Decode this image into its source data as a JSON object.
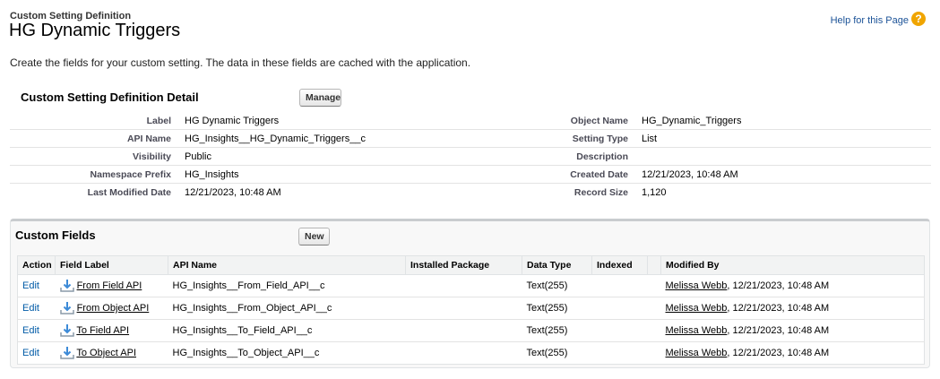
{
  "header": {
    "breadcrumb": "Custom Setting Definition",
    "title": "HG Dynamic Triggers",
    "help_link": "Help for this Page",
    "help_icon_glyph": "?",
    "description": "Create the fields for your custom setting. The data in these fields are cached with the application."
  },
  "detail": {
    "section_title": "Custom Setting Definition Detail",
    "manage_label": "Manage",
    "rows": [
      {
        "l1": "Label",
        "v1": "HG Dynamic Triggers",
        "l2": "Object Name",
        "v2": "HG_Dynamic_Triggers"
      },
      {
        "l1": "API Name",
        "v1": "HG_Insights__HG_Dynamic_Triggers__c",
        "l2": "Setting Type",
        "v2": "List"
      },
      {
        "l1": "Visibility",
        "v1": "Public",
        "l2": "Description",
        "v2": ""
      },
      {
        "l1": "Namespace Prefix",
        "v1": "HG_Insights",
        "l2": "Created Date",
        "v2": "12/21/2023, 10:48 AM"
      },
      {
        "l1": "Last Modified Date",
        "v1": "12/21/2023, 10:48 AM",
        "l2": "Record Size",
        "v2": "1,120"
      }
    ]
  },
  "custom_fields": {
    "section_title": "Custom Fields",
    "new_label": "New",
    "columns": [
      "Action",
      "Field Label",
      "API Name",
      "Installed Package",
      "Data Type",
      "Indexed",
      "",
      "Modified By"
    ],
    "rows": [
      {
        "action": "Edit",
        "field_label": "From Field API",
        "api_name": "HG_Insights__From_Field_API__c",
        "package": "",
        "data_type": "Text(255)",
        "indexed": "",
        "modified_user": "Melissa Webb",
        "modified_date": ", 12/21/2023, 10:48 AM"
      },
      {
        "action": "Edit",
        "field_label": "From Object API",
        "api_name": "HG_Insights__From_Object_API__c",
        "package": "",
        "data_type": "Text(255)",
        "indexed": "",
        "modified_user": "Melissa Webb",
        "modified_date": ", 12/21/2023, 10:48 AM"
      },
      {
        "action": "Edit",
        "field_label": "To Field API",
        "api_name": "HG_Insights__To_Field_API__c",
        "package": "",
        "data_type": "Text(255)",
        "indexed": "",
        "modified_user": "Melissa Webb",
        "modified_date": ", 12/21/2023, 10:48 AM"
      },
      {
        "action": "Edit",
        "field_label": "To Object API",
        "api_name": "HG_Insights__To_Object_API__c",
        "package": "",
        "data_type": "Text(255)",
        "indexed": "",
        "modified_user": "Melissa Webb",
        "modified_date": ", 12/21/2023, 10:48 AM"
      }
    ]
  },
  "colors": {
    "link": "#015ba7",
    "help_icon": "#f0a500",
    "header_bg": "#f2f3f3"
  },
  "icons": {
    "help": "question-circle-icon",
    "installed": "download-tray-icon"
  }
}
